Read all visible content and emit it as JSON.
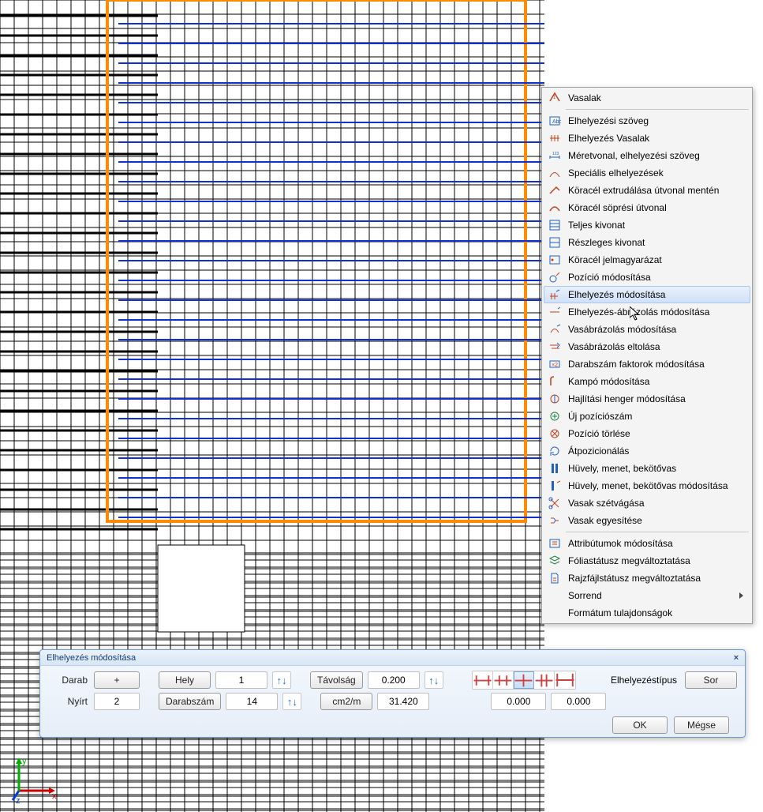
{
  "context_menu": {
    "items": [
      {
        "label": "Vasalak",
        "icon": "rebar-icon"
      },
      {
        "sep": true
      },
      {
        "label": "Elhelyezési szöveg",
        "icon": "text-icon"
      },
      {
        "label": "Elhelyezés Vasalak",
        "icon": "place-rebar-icon"
      },
      {
        "label": "Méretvonal, elhelyezési szöveg",
        "icon": "dimline-icon"
      },
      {
        "label": "Speciális elhelyezések",
        "icon": "special-place-icon"
      },
      {
        "label": "Köracél extrudálása útvonal mentén",
        "icon": "extrude-icon"
      },
      {
        "label": "Köracél söprési útvonal",
        "icon": "sweep-icon"
      },
      {
        "label": "Teljes kivonat",
        "icon": "full-schema-icon"
      },
      {
        "label": "Részleges kivonat",
        "icon": "partial-schema-icon"
      },
      {
        "label": "Köracél jelmagyarázat",
        "icon": "legend-icon"
      },
      {
        "label": "Pozíció módosítása",
        "icon": "edit-pos-icon"
      },
      {
        "label": "Elhelyezés módosítása",
        "icon": "edit-placement-icon",
        "hovered": true
      },
      {
        "label": "Elhelyezés-ábrázolás módosítása",
        "icon": "edit-place-rep-icon"
      },
      {
        "label": "Vasábrázolás módosítása",
        "icon": "edit-rebar-rep-icon"
      },
      {
        "label": "Vasábrázolás eltolása",
        "icon": "shift-rebar-icon"
      },
      {
        "label": "Darabszám faktorok módosítása",
        "icon": "count-factor-icon"
      },
      {
        "label": "Kampó módosítása",
        "icon": "hook-icon"
      },
      {
        "label": "Hajlítási henger módosítása",
        "icon": "bend-icon"
      },
      {
        "label": "Új pozíciószám",
        "icon": "new-pos-icon"
      },
      {
        "label": "Pozíció törlése",
        "icon": "del-pos-icon"
      },
      {
        "label": "Átpozicionálás",
        "icon": "repos-icon"
      },
      {
        "label": "Hüvely, menet, bekötővas",
        "icon": "sleeve-icon"
      },
      {
        "label": "Hüvely, menet, bekötővas módosítása",
        "icon": "sleeve-edit-icon"
      },
      {
        "label": "Vasak szétvágása",
        "icon": "cut-icon"
      },
      {
        "label": "Vasak egyesítése",
        "icon": "merge-icon"
      },
      {
        "sep": true
      },
      {
        "label": "Attribútumok módosítása",
        "icon": "attrib-icon"
      },
      {
        "label": "Fóliastátusz megváltoztatása",
        "icon": "layer-status-icon"
      },
      {
        "label": "Rajzfájlstátusz megváltoztatása",
        "icon": "file-status-icon"
      },
      {
        "label": "Sorrend",
        "icon": "",
        "submenu": true
      },
      {
        "label": "Formátum tulajdonságok",
        "icon": ""
      }
    ]
  },
  "dialog": {
    "title": "Elhelyezés módosítása",
    "labels": {
      "darab": "Darab",
      "nyirt": "Nyírt",
      "hely": "Hely",
      "darabszam": "Darabszám",
      "tavolsag": "Távolság",
      "cm2m": "cm2/m",
      "elhelyezes_tipus": "Elhelyezéstípus",
      "sor": "Sor",
      "plus": "+",
      "ok": "OK",
      "megse": "Mégse"
    },
    "values": {
      "hely_val": "1",
      "nyirt_val": "2",
      "darabszam_val": "14",
      "tavolsag_val": "0.200",
      "cm2m_val": "31.420",
      "ext1": "0.000",
      "ext2": "0.000"
    }
  },
  "axes": {
    "x": "x",
    "y": "y",
    "z": "z"
  }
}
